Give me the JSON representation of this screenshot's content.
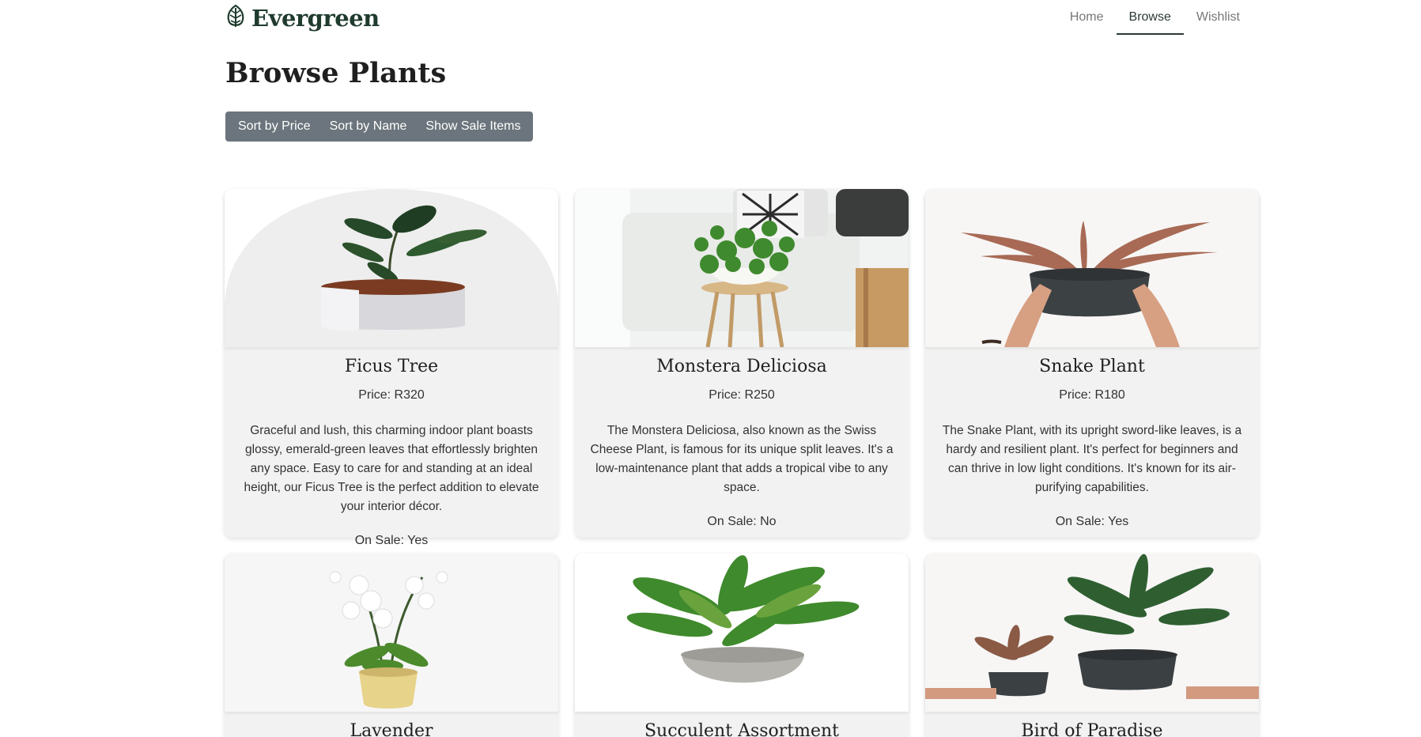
{
  "brand": {
    "name": "Evergreen",
    "icon": "leaf-logo-icon"
  },
  "nav": [
    {
      "label": "Home",
      "active": false
    },
    {
      "label": "Browse",
      "active": true
    },
    {
      "label": "Wishlist",
      "active": false
    }
  ],
  "page_title": "Browse Plants",
  "toolbar": {
    "sort_price": "Sort by Price",
    "sort_name": "Sort by Name",
    "show_sale": "Show Sale Items"
  },
  "products": [
    {
      "name": "Ficus Tree",
      "price": "Price: R320",
      "description": "Graceful and lush, this charming indoor plant boasts glossy, emerald-green leaves that effortlessly brighten any space. Easy to care for and standing at an ideal height, our Ficus Tree is the perfect addition to elevate your interior décor.",
      "sale": "On Sale: Yes"
    },
    {
      "name": "Monstera Deliciosa",
      "price": "Price: R250",
      "description": "The Monstera Deliciosa, also known as the Swiss Cheese Plant, is famous for its unique split leaves. It's a low-maintenance plant that adds a tropical vibe to any space.",
      "sale": "On Sale: No"
    },
    {
      "name": "Snake Plant",
      "price": "Price: R180",
      "description": "The Snake Plant, with its upright sword-like leaves, is a hardy and resilient plant. It's perfect for beginners and can thrive in low light conditions. It's known for its air-purifying capabilities.",
      "sale": "On Sale: Yes"
    },
    {
      "name": "Lavender"
    },
    {
      "name": "Succulent Assortment"
    },
    {
      "name": "Bird of Paradise"
    }
  ]
}
